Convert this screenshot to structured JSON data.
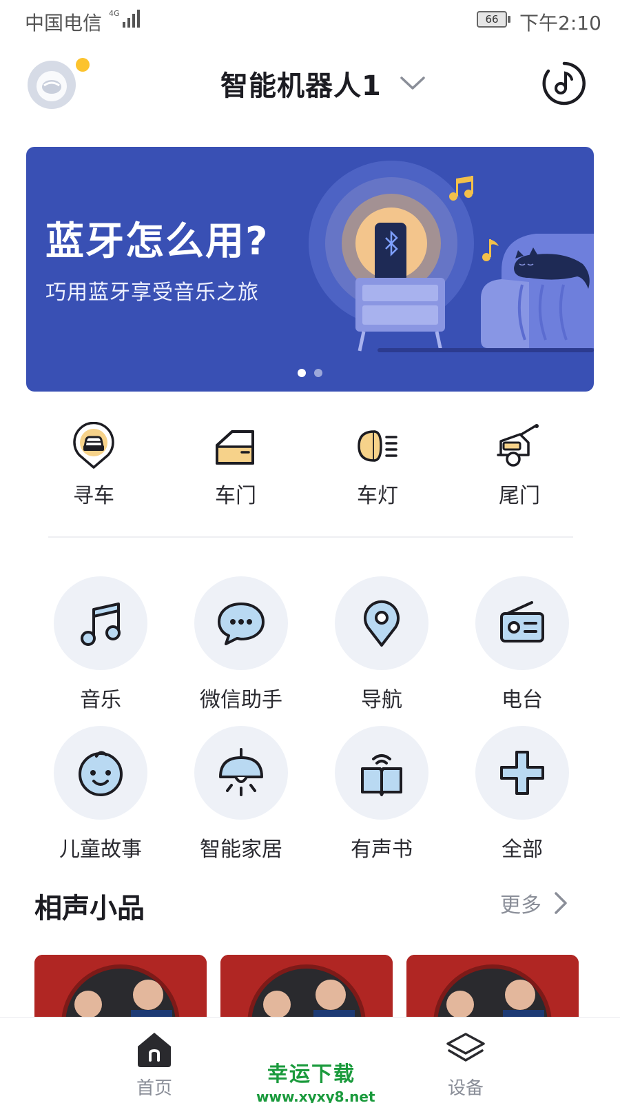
{
  "status_bar": {
    "carrier": "中国电信",
    "network": "4G",
    "battery": "66",
    "time": "下午2:10"
  },
  "header": {
    "robot_name": "智能机器人1"
  },
  "banner": {
    "title": "蓝牙怎么用?",
    "subtitle": "巧用蓝牙享受音乐之旅",
    "slide_index": 1,
    "slide_count": 2
  },
  "car_controls": [
    {
      "label": "寻车",
      "icon": "find-car-icon"
    },
    {
      "label": "车门",
      "icon": "car-door-icon"
    },
    {
      "label": "车灯",
      "icon": "headlight-icon"
    },
    {
      "label": "尾门",
      "icon": "tailgate-icon"
    }
  ],
  "services": [
    {
      "label": "音乐",
      "icon": "music-note-icon"
    },
    {
      "label": "微信助手",
      "icon": "chat-bubble-icon"
    },
    {
      "label": "导航",
      "icon": "location-pin-icon"
    },
    {
      "label": "电台",
      "icon": "radio-icon"
    },
    {
      "label": "儿童故事",
      "icon": "baby-face-icon"
    },
    {
      "label": "智能家居",
      "icon": "lamp-icon"
    },
    {
      "label": "有声书",
      "icon": "audiobook-icon"
    },
    {
      "label": "全部",
      "icon": "plus-icon"
    }
  ],
  "section": {
    "title": "相声小品",
    "more": "更多"
  },
  "bottom_nav": [
    {
      "label": "首页",
      "icon": "home-icon"
    },
    {
      "label": "设备",
      "icon": "layers-icon"
    }
  ],
  "watermark": {
    "title": "幸运下载",
    "url": "www.xyxy8.net"
  },
  "colors": {
    "banner_bg": "#3950b4",
    "accent_yellow": "#fcc32d",
    "icon_stroke": "#1c1c22",
    "icon_fill": "#b9d9f2",
    "card_red": "#b02623"
  }
}
